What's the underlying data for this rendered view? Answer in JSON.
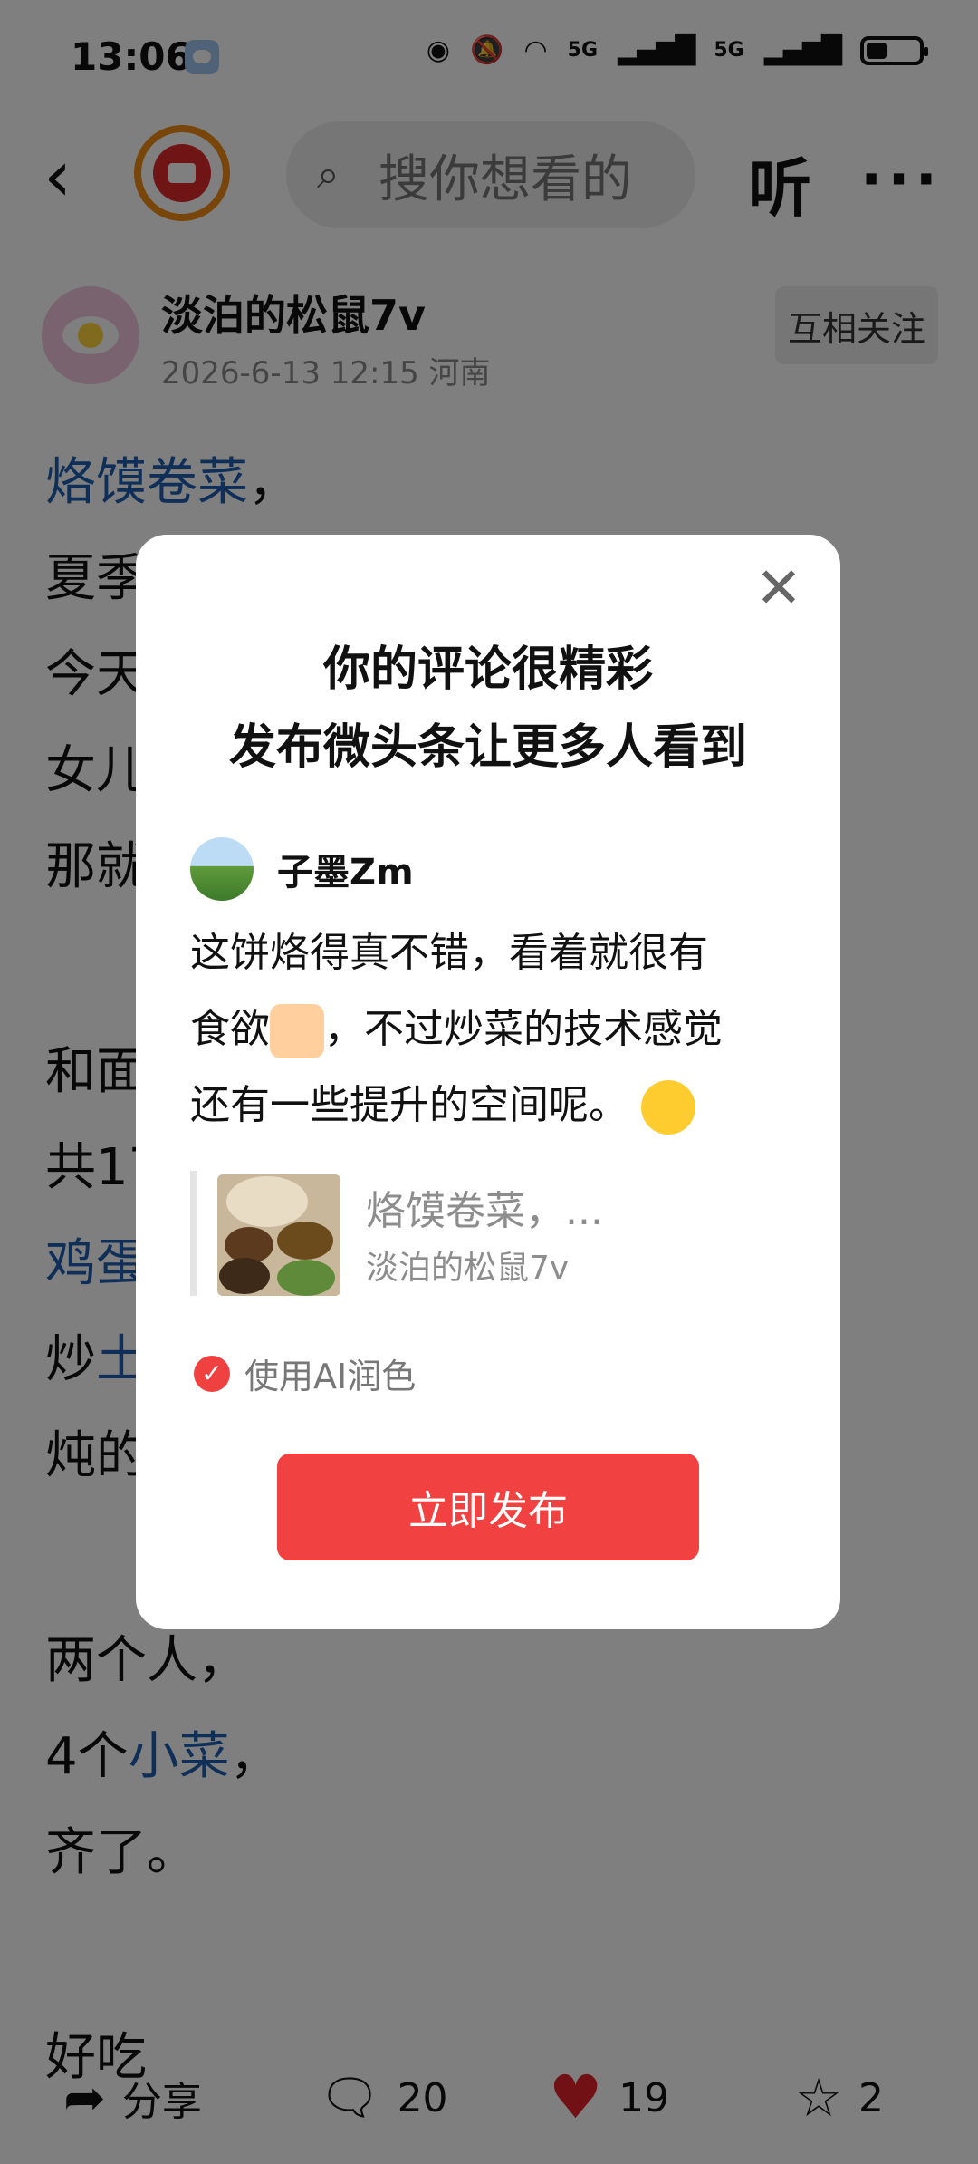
{
  "status_bar": {
    "time": "13:06",
    "network_1": "5G",
    "network_2": "5G",
    "icons": [
      "hd-voice-icon",
      "mute-bell-icon",
      "wifi-icon",
      "signal-icon",
      "signal-icon",
      "battery-icon"
    ]
  },
  "nav": {
    "search_placeholder": "搜你想看的",
    "listen_label": "听",
    "more_label": "···"
  },
  "author": {
    "name": "淡泊的松鼠7v",
    "meta": "2026-6-13 12:15 河南",
    "follow_label": "互相关注"
  },
  "article": {
    "lines": [
      {
        "parts": [
          {
            "text": "烙馍卷菜",
            "link": true
          },
          {
            "text": "，",
            "link": false
          }
        ]
      },
      {
        "parts": [
          {
            "text": "夏季",
            "link": false
          }
        ]
      },
      {
        "parts": [
          {
            "text": "今天",
            "link": false
          }
        ]
      },
      {
        "parts": [
          {
            "text": "女儿",
            "link": false
          }
        ]
      },
      {
        "parts": [
          {
            "text": "那就",
            "link": false
          }
        ]
      },
      {
        "parts": [
          {
            "text": "和面",
            "link": false
          }
        ]
      },
      {
        "parts": [
          {
            "text": "共17",
            "link": false
          }
        ]
      },
      {
        "parts": [
          {
            "text": "鸡蛋",
            "link": true
          }
        ]
      },
      {
        "parts": [
          {
            "text": "炒",
            "link": false
          },
          {
            "text": "土",
            "link": true
          }
        ]
      },
      {
        "parts": [
          {
            "text": "炖的",
            "link": false
          }
        ]
      },
      {
        "parts": [
          {
            "text": "两个人，",
            "link": false
          }
        ]
      },
      {
        "parts": [
          {
            "text": "4个",
            "link": false
          },
          {
            "text": "小菜",
            "link": true
          },
          {
            "text": "，",
            "link": false
          }
        ]
      },
      {
        "parts": [
          {
            "text": "齐了。",
            "link": false
          }
        ]
      },
      {
        "parts": [
          {
            "text": "好吃",
            "link": false
          }
        ]
      }
    ]
  },
  "bottom_bar": {
    "share_label": "分享",
    "comment_count": "20",
    "like_count": "19",
    "favorite_count": "2"
  },
  "modal": {
    "title_line1": "你的评论很精彩",
    "title_line2": "发布微头条让更多人看到",
    "commenter_name": "子墨Zm",
    "comment_line1": "这饼烙得真不错，看着就很有",
    "comment_line2_a": "食欲",
    "comment_line2_b": "，不过炒菜的技术感觉",
    "comment_line3": "还有一些提升的空间呢。",
    "quote_title": "烙馍卷菜，...",
    "quote_author": "淡泊的松鼠7v",
    "ai_polish_label": "使用AI润色",
    "ai_polish_checked": true,
    "publish_label": "立即发布",
    "accent_color": "#f24141"
  }
}
